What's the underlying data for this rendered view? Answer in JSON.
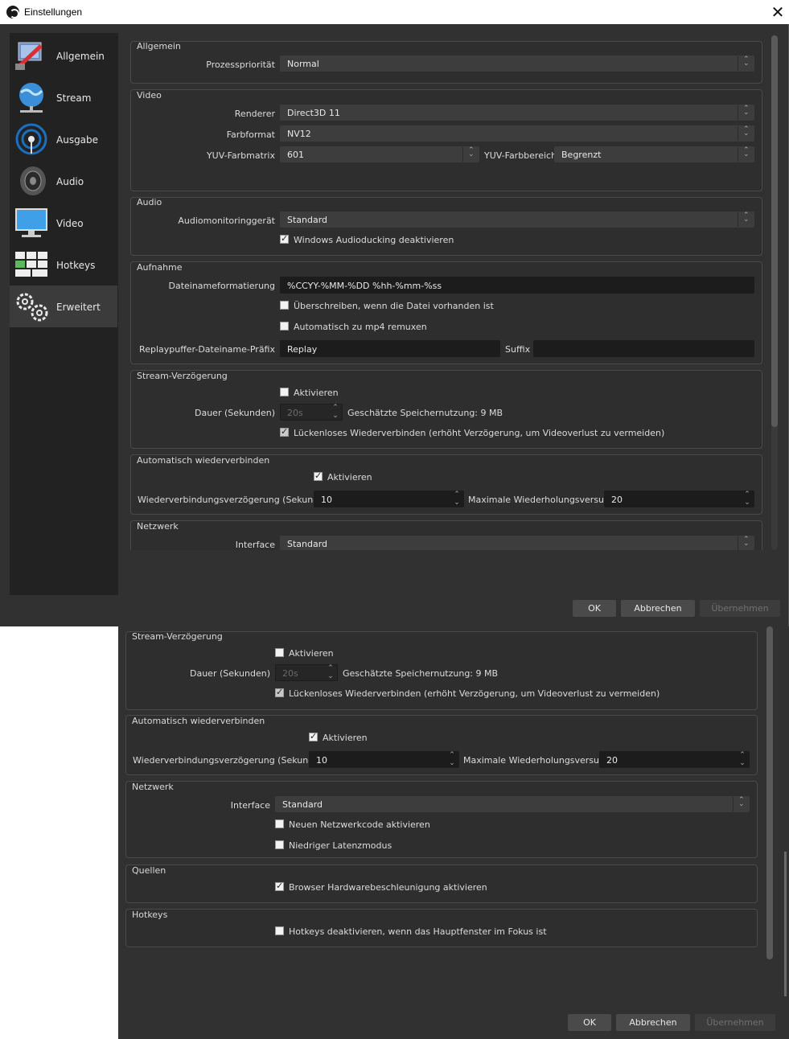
{
  "window": {
    "title": "Einstellungen",
    "close_glyph": "✕"
  },
  "sidebar": {
    "items": [
      {
        "label": "Allgemein",
        "icon": "settings-general-icon"
      },
      {
        "label": "Stream",
        "icon": "globe-network-icon"
      },
      {
        "label": "Ausgabe",
        "icon": "broadcast-antenna-icon"
      },
      {
        "label": "Audio",
        "icon": "speaker-icon"
      },
      {
        "label": "Video",
        "icon": "monitor-icon"
      },
      {
        "label": "Hotkeys",
        "icon": "keyboard-icon"
      },
      {
        "label": "Erweitert",
        "icon": "gears-icon"
      }
    ],
    "active_index": 6
  },
  "allgemein": {
    "title": "Allgemein",
    "priority_label": "Prozesspriorität",
    "priority_value": "Normal"
  },
  "video": {
    "title": "Video",
    "renderer_label": "Renderer",
    "renderer_value": "Direct3D 11",
    "format_label": "Farbformat",
    "format_value": "NV12",
    "matrix_label": "YUV-Farbmatrix",
    "matrix_value": "601",
    "range_label": "YUV-Farbbereich",
    "range_value": "Begrenzt"
  },
  "audio": {
    "title": "Audio",
    "monitor_label": "Audiomonitoringgerät",
    "monitor_value": "Standard",
    "ducking_label": "Windows Audioducking deaktivieren",
    "ducking_checked": true
  },
  "aufnahme": {
    "title": "Aufnahme",
    "filename_label": "Dateinameformatierung",
    "filename_value": "%CCYY-%MM-%DD %hh-%mm-%ss",
    "overwrite_label": "Überschreiben, wenn die Datei vorhanden ist",
    "remux_label": "Automatisch zu mp4 remuxen",
    "replay_prefix_label": "Replaypuffer-Dateiname-Präfix",
    "replay_prefix_value": "Replay",
    "suffix_label": "Suffix",
    "suffix_value": ""
  },
  "stream_delay": {
    "title": "Stream-Verzögerung",
    "enable_label": "Aktivieren",
    "duration_label": "Dauer (Sekunden)",
    "duration_value": "20s",
    "memory_label": "Geschätzte Speichernutzung: 9 MB",
    "seamless_label": "Lückenloses Wiederverbinden (erhöht Verzögerung, um Videoverlust zu vermeiden)"
  },
  "reconnect": {
    "title": "Automatisch wiederverbinden",
    "enable_label": "Aktivieren",
    "delay_label": "Wiederverbindungsverzögerung (Sekunden)",
    "delay_value": "10",
    "retries_label": "Maximale Wiederholungsversuche",
    "retries_value": "20"
  },
  "network": {
    "title": "Netzwerk",
    "interface_label": "Interface",
    "interface_value": "Standard",
    "netcode_label": "Neuen Netzwerkcode aktivieren",
    "latency_label": "Niedriger Latenzmodus"
  },
  "sources": {
    "title": "Quellen",
    "hw_accel_label": "Browser Hardwarebeschleunigung aktivieren"
  },
  "hotkeys": {
    "title": "Hotkeys",
    "disable_label": "Hotkeys deaktivieren, wenn das Hauptfenster im Fokus ist"
  },
  "buttons": {
    "ok": "OK",
    "cancel": "Abbrechen",
    "apply": "Übernehmen"
  },
  "arrows": {
    "up": "⌃",
    "down": "⌄"
  }
}
